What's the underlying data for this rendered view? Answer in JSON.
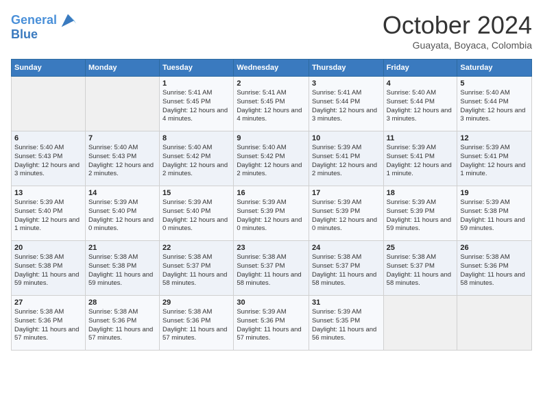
{
  "header": {
    "logo_line1": "General",
    "logo_line2": "Blue",
    "month": "October 2024",
    "location": "Guayata, Boyaca, Colombia"
  },
  "days_of_week": [
    "Sunday",
    "Monday",
    "Tuesday",
    "Wednesday",
    "Thursday",
    "Friday",
    "Saturday"
  ],
  "weeks": [
    [
      {
        "day": "",
        "info": ""
      },
      {
        "day": "",
        "info": ""
      },
      {
        "day": "1",
        "info": "Sunrise: 5:41 AM\nSunset: 5:45 PM\nDaylight: 12 hours and 4 minutes."
      },
      {
        "day": "2",
        "info": "Sunrise: 5:41 AM\nSunset: 5:45 PM\nDaylight: 12 hours and 4 minutes."
      },
      {
        "day": "3",
        "info": "Sunrise: 5:41 AM\nSunset: 5:44 PM\nDaylight: 12 hours and 3 minutes."
      },
      {
        "day": "4",
        "info": "Sunrise: 5:40 AM\nSunset: 5:44 PM\nDaylight: 12 hours and 3 minutes."
      },
      {
        "day": "5",
        "info": "Sunrise: 5:40 AM\nSunset: 5:44 PM\nDaylight: 12 hours and 3 minutes."
      }
    ],
    [
      {
        "day": "6",
        "info": "Sunrise: 5:40 AM\nSunset: 5:43 PM\nDaylight: 12 hours and 3 minutes."
      },
      {
        "day": "7",
        "info": "Sunrise: 5:40 AM\nSunset: 5:43 PM\nDaylight: 12 hours and 2 minutes."
      },
      {
        "day": "8",
        "info": "Sunrise: 5:40 AM\nSunset: 5:42 PM\nDaylight: 12 hours and 2 minutes."
      },
      {
        "day": "9",
        "info": "Sunrise: 5:40 AM\nSunset: 5:42 PM\nDaylight: 12 hours and 2 minutes."
      },
      {
        "day": "10",
        "info": "Sunrise: 5:39 AM\nSunset: 5:41 PM\nDaylight: 12 hours and 2 minutes."
      },
      {
        "day": "11",
        "info": "Sunrise: 5:39 AM\nSunset: 5:41 PM\nDaylight: 12 hours and 1 minute."
      },
      {
        "day": "12",
        "info": "Sunrise: 5:39 AM\nSunset: 5:41 PM\nDaylight: 12 hours and 1 minute."
      }
    ],
    [
      {
        "day": "13",
        "info": "Sunrise: 5:39 AM\nSunset: 5:40 PM\nDaylight: 12 hours and 1 minute."
      },
      {
        "day": "14",
        "info": "Sunrise: 5:39 AM\nSunset: 5:40 PM\nDaylight: 12 hours and 0 minutes."
      },
      {
        "day": "15",
        "info": "Sunrise: 5:39 AM\nSunset: 5:40 PM\nDaylight: 12 hours and 0 minutes."
      },
      {
        "day": "16",
        "info": "Sunrise: 5:39 AM\nSunset: 5:39 PM\nDaylight: 12 hours and 0 minutes."
      },
      {
        "day": "17",
        "info": "Sunrise: 5:39 AM\nSunset: 5:39 PM\nDaylight: 12 hours and 0 minutes."
      },
      {
        "day": "18",
        "info": "Sunrise: 5:39 AM\nSunset: 5:39 PM\nDaylight: 11 hours and 59 minutes."
      },
      {
        "day": "19",
        "info": "Sunrise: 5:39 AM\nSunset: 5:38 PM\nDaylight: 11 hours and 59 minutes."
      }
    ],
    [
      {
        "day": "20",
        "info": "Sunrise: 5:38 AM\nSunset: 5:38 PM\nDaylight: 11 hours and 59 minutes."
      },
      {
        "day": "21",
        "info": "Sunrise: 5:38 AM\nSunset: 5:38 PM\nDaylight: 11 hours and 59 minutes."
      },
      {
        "day": "22",
        "info": "Sunrise: 5:38 AM\nSunset: 5:37 PM\nDaylight: 11 hours and 58 minutes."
      },
      {
        "day": "23",
        "info": "Sunrise: 5:38 AM\nSunset: 5:37 PM\nDaylight: 11 hours and 58 minutes."
      },
      {
        "day": "24",
        "info": "Sunrise: 5:38 AM\nSunset: 5:37 PM\nDaylight: 11 hours and 58 minutes."
      },
      {
        "day": "25",
        "info": "Sunrise: 5:38 AM\nSunset: 5:37 PM\nDaylight: 11 hours and 58 minutes."
      },
      {
        "day": "26",
        "info": "Sunrise: 5:38 AM\nSunset: 5:36 PM\nDaylight: 11 hours and 58 minutes."
      }
    ],
    [
      {
        "day": "27",
        "info": "Sunrise: 5:38 AM\nSunset: 5:36 PM\nDaylight: 11 hours and 57 minutes."
      },
      {
        "day": "28",
        "info": "Sunrise: 5:38 AM\nSunset: 5:36 PM\nDaylight: 11 hours and 57 minutes."
      },
      {
        "day": "29",
        "info": "Sunrise: 5:38 AM\nSunset: 5:36 PM\nDaylight: 11 hours and 57 minutes."
      },
      {
        "day": "30",
        "info": "Sunrise: 5:39 AM\nSunset: 5:36 PM\nDaylight: 11 hours and 57 minutes."
      },
      {
        "day": "31",
        "info": "Sunrise: 5:39 AM\nSunset: 5:35 PM\nDaylight: 11 hours and 56 minutes."
      },
      {
        "day": "",
        "info": ""
      },
      {
        "day": "",
        "info": ""
      }
    ]
  ]
}
